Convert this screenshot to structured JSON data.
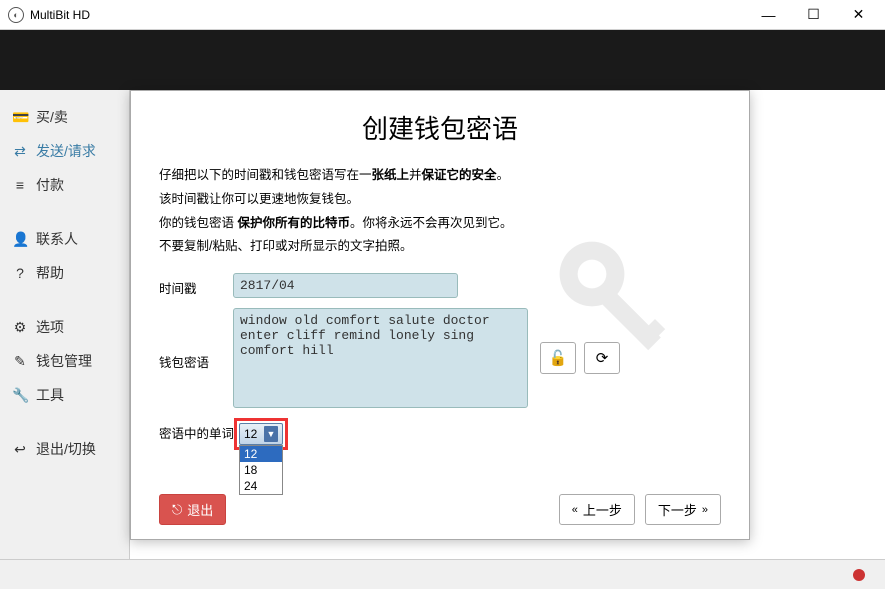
{
  "window": {
    "title": "MultiBit HD"
  },
  "titlebar_controls": {
    "min": "—",
    "max": "☐",
    "close": "✕"
  },
  "sidebar": {
    "items": [
      {
        "icon": "💳",
        "label": "买/卖"
      },
      {
        "icon": "⇄",
        "label": "发送/请求"
      },
      {
        "icon": "≡",
        "label": "付款"
      },
      {
        "icon": "👤",
        "label": "联系人"
      },
      {
        "icon": "?",
        "label": "帮助"
      },
      {
        "icon": "⚙",
        "label": "选项"
      },
      {
        "icon": "✎",
        "label": "钱包管理"
      },
      {
        "icon": "🔧",
        "label": "工具"
      },
      {
        "icon": "↩",
        "label": "退出/切换"
      }
    ]
  },
  "dialog": {
    "title": "创建钱包密语",
    "info": {
      "l1a": "仔细把以下的时间戳和钱包密语写在一",
      "l1b": "张纸上",
      "l1c": "并",
      "l1d": "保证它的安全",
      "l1e": "。",
      "l2": "该时间戳让你可以更速地恢复钱包。",
      "l3a": "你的钱包密语 ",
      "l3b": "保护你所有的比特币",
      "l3c": "。你将永远不会再次见到它。",
      "l4": "不要复制/粘贴、打印或对所显示的文字拍照。"
    },
    "timestamp": {
      "label": "时间戳",
      "value": "2817/04"
    },
    "seed": {
      "label": "钱包密语",
      "value": "window old comfort salute doctor\nenter cliff remind lonely sing\ncomfort hill"
    },
    "words": {
      "label": "密语中的单词",
      "selected": "12",
      "options": [
        "12",
        "18",
        "24"
      ]
    },
    "buttons": {
      "exit": "退出",
      "prev": "上一步",
      "next": "下一步",
      "arrow_left": "«",
      "arrow_right": "»"
    },
    "icons": {
      "unlock": "🔓",
      "refresh": "⟳"
    }
  }
}
